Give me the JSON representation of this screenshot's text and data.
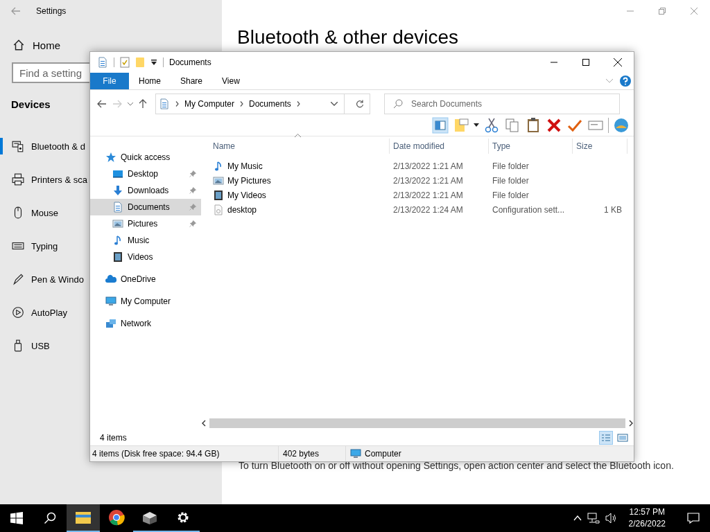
{
  "settings": {
    "title": "Settings",
    "home": "Home",
    "search": {
      "placeholder": "Find a setting"
    },
    "section": "Devices",
    "nav": [
      {
        "kind": "bluetooth",
        "label": "Bluetooth & d",
        "selected": true
      },
      {
        "kind": "printer",
        "label": "Printers & sca",
        "selected": false
      },
      {
        "kind": "mouse",
        "label": "Mouse",
        "selected": false
      },
      {
        "kind": "keyboard",
        "label": "Typing",
        "selected": false
      },
      {
        "kind": "pen",
        "label": "Pen & Windo",
        "selected": false
      },
      {
        "kind": "autoplay",
        "label": "AutoPlay",
        "selected": false
      },
      {
        "kind": "usb",
        "label": "USB",
        "selected": false
      }
    ],
    "heading": "Bluetooth & other devices",
    "note": "To turn Bluetooth on or off without opening Settings, open action center and select the Bluetooth icon."
  },
  "explorer": {
    "title": "Documents",
    "ribbon_tabs": [
      {
        "kind": "file",
        "label": "File"
      },
      {
        "kind": "tab",
        "label": "Home"
      },
      {
        "kind": "tab",
        "label": "Share"
      },
      {
        "kind": "tab",
        "label": "View"
      }
    ],
    "breadcrumbs": [
      "My Computer",
      "Documents"
    ],
    "search": {
      "placeholder": "Search Documents"
    },
    "nav": [
      {
        "kind": "star",
        "label": "Quick access",
        "selected": false,
        "children": [
          {
            "kind": "desktop",
            "label": "Desktop",
            "pinned": true,
            "selected": false
          },
          {
            "kind": "download",
            "label": "Downloads",
            "pinned": true,
            "selected": false
          },
          {
            "kind": "document",
            "label": "Documents",
            "pinned": true,
            "selected": true
          },
          {
            "kind": "picture",
            "label": "Pictures",
            "pinned": true,
            "selected": false
          },
          {
            "kind": "music",
            "label": "Music",
            "pinned": false,
            "selected": false
          },
          {
            "kind": "video",
            "label": "Videos",
            "pinned": false,
            "selected": false
          }
        ]
      },
      {
        "kind": "cloud",
        "label": "OneDrive",
        "selected": false
      },
      {
        "kind": "computer",
        "label": "My Computer",
        "selected": false
      },
      {
        "kind": "network",
        "label": "Network",
        "selected": false
      }
    ],
    "columns": [
      "Name",
      "Date modified",
      "Type",
      "Size"
    ],
    "rows": [
      {
        "kind": "music",
        "name": "My Music",
        "date": "2/13/2022 1:21 AM",
        "type": "File folder"
      },
      {
        "kind": "picture",
        "name": "My Pictures",
        "date": "2/13/2022 1:21 AM",
        "type": "File folder"
      },
      {
        "kind": "video",
        "name": "My Videos",
        "date": "2/13/2022 1:21 AM",
        "type": "File folder"
      },
      {
        "kind": "file",
        "name": "desktop",
        "date": "2/13/2022 1:24 AM",
        "type": "Configuration sett...",
        "size": "1 KB"
      }
    ],
    "item_count": "4 items",
    "status_bar": {
      "summary": "4 items (Disk free space: 94.4 GB)",
      "size": "402 bytes",
      "location": "Computer"
    }
  },
  "taskbar": {
    "apps": [
      {
        "kind": "explorer",
        "running": true,
        "selected": true
      },
      {
        "kind": "chrome",
        "running": false,
        "selected": false
      },
      {
        "kind": "cube",
        "running": true,
        "selected": false
      },
      {
        "kind": "gear",
        "running": true,
        "selected": false
      }
    ],
    "time": "12:57 PM",
    "date": "2/26/2022"
  }
}
